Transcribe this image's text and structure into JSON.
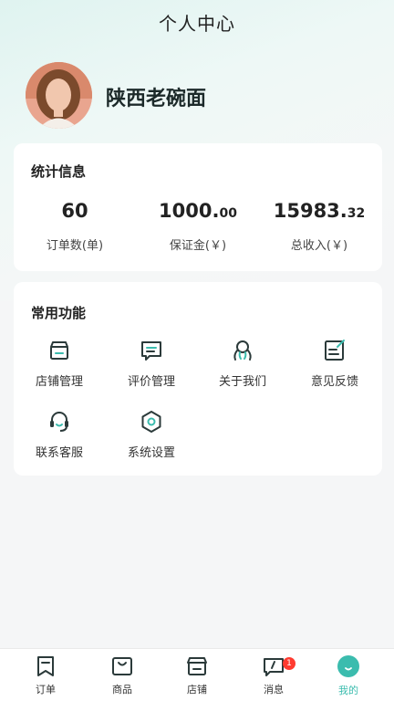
{
  "page": {
    "title": "个人中心"
  },
  "user": {
    "name": "陕西老碗面"
  },
  "stats": {
    "title": "统计信息",
    "items": [
      {
        "value": "60",
        "decimal": "",
        "label": "订单数(单)"
      },
      {
        "value": "1000.",
        "decimal": "00",
        "label": "保证金(￥)"
      },
      {
        "value": "15983.",
        "decimal": "32",
        "label": "总收入(￥)"
      }
    ]
  },
  "functions": {
    "title": "常用功能",
    "items": [
      {
        "label": "店铺管理",
        "icon": "store-icon"
      },
      {
        "label": "评价管理",
        "icon": "comment-icon"
      },
      {
        "label": "关于我们",
        "icon": "about-icon"
      },
      {
        "label": "意见反馈",
        "icon": "feedback-icon"
      },
      {
        "label": "联系客服",
        "icon": "headset-icon"
      },
      {
        "label": "系统设置",
        "icon": "settings-icon"
      }
    ]
  },
  "tabbar": {
    "items": [
      {
        "label": "订单",
        "icon": "order-icon"
      },
      {
        "label": "商品",
        "icon": "goods-icon"
      },
      {
        "label": "店铺",
        "icon": "shop-icon"
      },
      {
        "label": "消息",
        "icon": "message-icon",
        "badge": "1"
      },
      {
        "label": "我的",
        "icon": "me-icon",
        "active": true
      }
    ]
  },
  "colors": {
    "accent": "#3bbcae",
    "icon": "#2b3a3a",
    "badge": "#ff3b30"
  }
}
